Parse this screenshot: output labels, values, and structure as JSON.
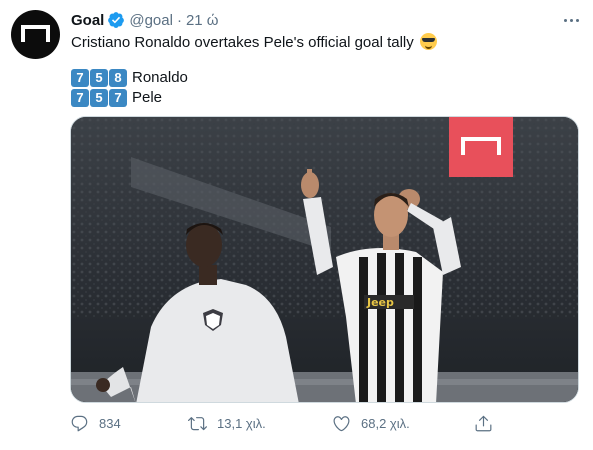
{
  "tweet": {
    "display_name": "Goal",
    "handle": "@goal",
    "separator": "·",
    "time": "21 ώ",
    "text": "Cristiano Ronaldo overtakes Pele's official goal tally",
    "scores": [
      {
        "digits": [
          "7",
          "5",
          "8"
        ],
        "name": "Ronaldo"
      },
      {
        "digits": [
          "7",
          "5",
          "7"
        ],
        "name": "Pele"
      }
    ]
  },
  "actions": {
    "replies": "834",
    "retweets": "13,1 χιλ.",
    "likes": "68,2 χιλ."
  },
  "icons": {
    "verified": "verified-badge-icon",
    "more": "more-icon",
    "reply": "reply-icon",
    "retweet": "retweet-icon",
    "like": "heart-icon",
    "share": "share-icon",
    "emoji": "sunglasses-emoji-icon"
  },
  "colors": {
    "accent_blue": "#1d9bf0",
    "muted_text": "#5b7083",
    "keycap_blue": "#3b88c3",
    "goal_logo_red": "#e8505b"
  }
}
